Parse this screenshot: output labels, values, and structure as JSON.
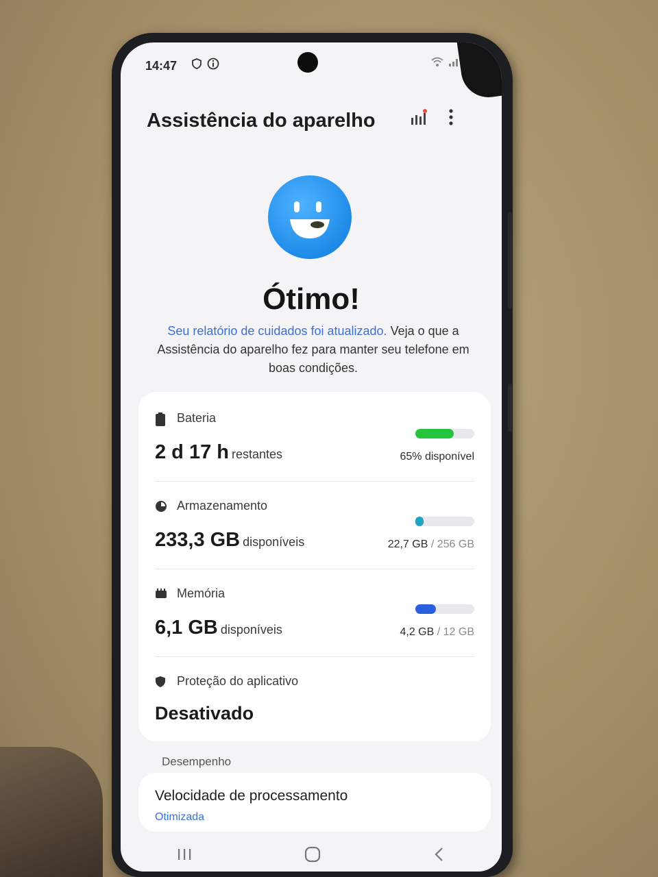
{
  "status_bar": {
    "time": "14:47"
  },
  "header": {
    "title": "Assistência do aparelho"
  },
  "hero": {
    "status": "Ótimo!",
    "desc_link": "Seu relatório de cuidados foi atualizado.",
    "desc_text": " Veja o que a Assistência do aparelho fez para manter seu telefone em boas condições."
  },
  "battery": {
    "label": "Bateria",
    "value": "2 d 17 h",
    "unit": "restantes",
    "available": "65% disponível",
    "level": 0.65,
    "color": "#25c43a"
  },
  "storage": {
    "label": "Armazenamento",
    "value": "233,3 GB",
    "unit": "disponíveis",
    "used": "22,7 GB",
    "total": "/ 256 GB",
    "level": 0.09,
    "color": "#1fa3c2"
  },
  "memory": {
    "label": "Memória",
    "value": "6,1 GB",
    "unit": "disponíveis",
    "used": "4,2 GB",
    "total": "/ 12 GB",
    "level": 0.35,
    "color": "#2a5fe0"
  },
  "app_protection": {
    "label": "Proteção do aplicativo",
    "value": "Desativado"
  },
  "performance": {
    "section": "Desempenho",
    "title": "Velocidade de processamento",
    "status": "Otimizada"
  }
}
